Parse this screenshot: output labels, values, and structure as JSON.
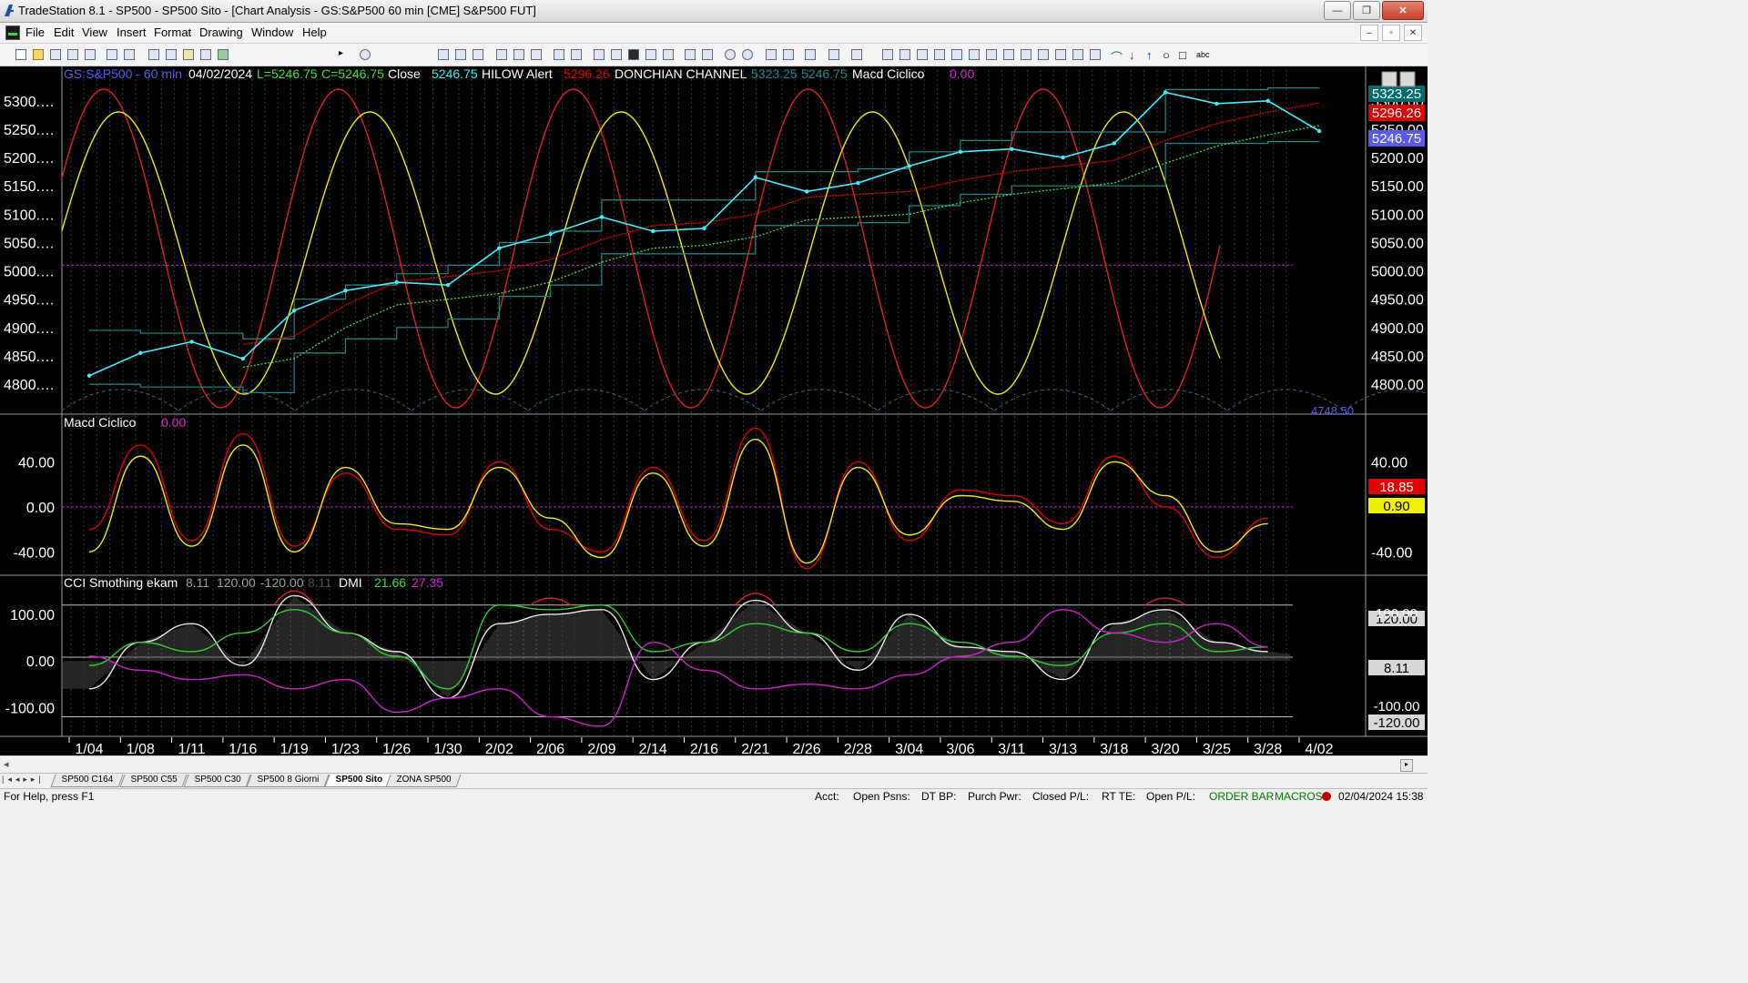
{
  "window": {
    "title": "TradeStation 8.1 - SP500 - SP500 Sito - [Chart Analysis - GS:S&P500  60 min  [CME] S&P500 FUT]",
    "buttons": {
      "minimize": "—",
      "restore": "❐",
      "close": "✕"
    }
  },
  "menu": [
    "File",
    "Edit",
    "View",
    "Insert",
    "Format",
    "Drawing",
    "Window",
    "Help"
  ],
  "mdi_buttons": [
    "–",
    "▫",
    "✕"
  ],
  "header": {
    "symbol": "GS:S&P500 - 60 min",
    "date": "04/02/2024",
    "low": "L=5246.75",
    "close": "C=5246.75",
    "close_label": "Close",
    "close_value": "5246.75",
    "hilow_label": "HILOW Alert",
    "hilow_value": "5296.26",
    "donchian_label": "DONCHIAN CHANNEL",
    "donchian_upper": "5323.25",
    "donchian_lower": "5246.75",
    "macd_label": "Macd Ciclico",
    "macd_value": "0.00"
  },
  "price_axis": {
    "ticks": [
      "5300.00",
      "5250.00",
      "5200.00",
      "5150.00",
      "5100.00",
      "5050.00",
      "5000.00",
      "4950.00",
      "4900.00",
      "4850.00",
      "4800.00"
    ],
    "left_ticks": [
      "5300.…",
      "5250.…",
      "5200.…",
      "5150.…",
      "5100.…",
      "5050.…",
      "5000.…",
      "4950.…",
      "4900.…",
      "4850.…",
      "4800.…"
    ],
    "markers": [
      {
        "text": "5323.25",
        "color": "#006d6d"
      },
      {
        "text": "5296.26",
        "color": "#e00000"
      },
      {
        "text": "5246.75",
        "color": "#5a5af0"
      }
    ],
    "bottom_label": "4748.50"
  },
  "macd_panel": {
    "title": "Macd Ciclico",
    "value": "0.00",
    "ticks": [
      "40.00",
      "0.00",
      "-40.00"
    ],
    "markers": [
      {
        "text": "18.85",
        "color": "#e00000"
      },
      {
        "text": "0.90",
        "color": "#f0f000"
      }
    ]
  },
  "cci_panel": {
    "title": "CCI Smothing ekam",
    "values": [
      "8.11",
      "120.00",
      "-120.00",
      "8.11"
    ],
    "dmi_label": "DMI",
    "dmi_plus": "21.66",
    "dmi_minus": "27.35",
    "ticks": [
      "100.00",
      "0.00",
      "-100.00"
    ],
    "markers": [
      {
        "text": "120.00",
        "color": "#d8d8d8"
      },
      {
        "text": "8.11",
        "color": "#d8d8d8"
      },
      {
        "text": "-120.00",
        "color": "#d8d8d8"
      }
    ],
    "hidden_marks": [
      "100.00",
      "-100.00"
    ]
  },
  "date_axis": [
    "1/04",
    "1/08",
    "1/11",
    "1/16",
    "1/19",
    "1/23",
    "1/26",
    "1/30",
    "2/02",
    "2/06",
    "2/09",
    "2/14",
    "2/16",
    "2/21",
    "2/26",
    "2/28",
    "3/04",
    "3/06",
    "3/11",
    "3/13",
    "3/18",
    "3/20",
    "3/25",
    "3/28",
    "4/02"
  ],
  "chart_data": {
    "type": "line",
    "title": "GS:S&P500 - 60 min",
    "x": [
      "1/04",
      "1/08",
      "1/11",
      "1/16",
      "1/19",
      "1/23",
      "1/26",
      "1/30",
      "2/02",
      "2/06",
      "2/09",
      "2/14",
      "2/16",
      "2/21",
      "2/26",
      "2/28",
      "3/04",
      "3/06",
      "3/11",
      "3/13",
      "3/18",
      "3/20",
      "3/25",
      "3/28",
      "4/02"
    ],
    "ylim": [
      4760,
      5335
    ],
    "series": [
      {
        "name": "Close",
        "color": "#3ef0ff",
        "values": [
          4815,
          4855,
          4875,
          4845,
          4930,
          4965,
          4980,
          4975,
          5040,
          5065,
          5095,
          5070,
          5075,
          5165,
          5140,
          5155,
          5185,
          5210,
          5215,
          5200,
          5225,
          5315,
          5295,
          5300,
          5246.75
        ]
      },
      {
        "name": "HILOW Alert",
        "color": "#e00000",
        "values": [
          null,
          null,
          null,
          4870,
          4885,
          4940,
          4980,
          4990,
          5000,
          5020,
          5055,
          5080,
          5085,
          5100,
          5130,
          5135,
          5140,
          5160,
          5175,
          5185,
          5195,
          5230,
          5260,
          5280,
          5296.26
        ]
      },
      {
        "name": "DONCHIAN CHANNEL",
        "color": "#1e8a8a",
        "values": [
          4895,
          4890,
          4890,
          4880,
          4950,
          4975,
          4995,
          5010,
          5050,
          5070,
          5125,
          5125,
          5125,
          5175,
          5175,
          5180,
          5210,
          5230,
          5245,
          5245,
          5245,
          5320,
          5320,
          5323,
          5323.25
        ]
      }
    ],
    "macd": {
      "ylim": [
        -60,
        80
      ],
      "ticks": [
        40,
        0,
        -40
      ],
      "fast_color": "#e00000",
      "slow_color": "#f0f000",
      "fast": [
        -20,
        55,
        -30,
        65,
        -35,
        30,
        -20,
        -25,
        40,
        -20,
        -40,
        35,
        -30,
        70,
        -55,
        40,
        -30,
        15,
        10,
        -15,
        45,
        0,
        -45,
        -10,
        18.85
      ],
      "slow": [
        -40,
        45,
        -35,
        55,
        -40,
        35,
        -15,
        -20,
        35,
        -10,
        -45,
        30,
        -35,
        60,
        -50,
        35,
        -25,
        10,
        5,
        -20,
        40,
        10,
        -40,
        -15,
        0.9
      ]
    },
    "cci": {
      "ylim": [
        -160,
        180
      ],
      "ticks": [
        100,
        0,
        -100
      ],
      "levels": [
        120,
        8.11,
        -120
      ],
      "cci": [
        -60,
        40,
        80,
        -10,
        140,
        60,
        20,
        -80,
        80,
        100,
        110,
        -40,
        40,
        130,
        60,
        -20,
        100,
        30,
        20,
        -40,
        80,
        110,
        40,
        20,
        8.11
      ],
      "dmi_plus": [
        -10,
        40,
        20,
        60,
        110,
        60,
        10,
        -60,
        120,
        110,
        120,
        20,
        40,
        80,
        60,
        20,
        80,
        40,
        10,
        -10,
        60,
        80,
        20,
        30,
        21.66
      ],
      "dmi_minus": [
        10,
        -20,
        -40,
        -30,
        -60,
        -40,
        -110,
        -80,
        -60,
        -120,
        -140,
        40,
        -20,
        -60,
        -50,
        -60,
        -30,
        10,
        40,
        110,
        60,
        40,
        80,
        30,
        27.35
      ]
    }
  }
}
